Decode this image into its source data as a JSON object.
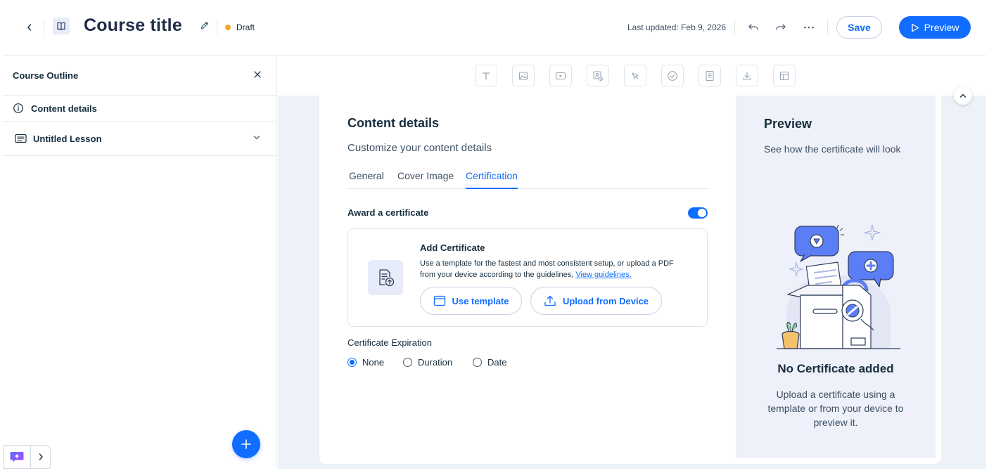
{
  "header": {
    "title": "Course title",
    "status": "Draft",
    "last_updated": "Last updated: Feb 9, 2026",
    "save_label": "Save",
    "preview_label": "Preview",
    "status_color": "#f5a623",
    "accent_color": "#116dff"
  },
  "sidebar": {
    "title": "Course Outline",
    "items": [
      {
        "label": "Content details",
        "icon": "info-icon"
      },
      {
        "label": "Untitled Lesson",
        "icon": "lesson-icon"
      }
    ]
  },
  "toolbar": {
    "tools": [
      "text-icon",
      "image-icon",
      "video-icon",
      "media-icon",
      "cursor-icon",
      "check-icon",
      "document-icon",
      "download-icon",
      "layout-icon"
    ]
  },
  "content": {
    "title": "Content details",
    "subtitle": "Customize your content details",
    "tabs": [
      "General",
      "Cover Image",
      "Certification"
    ],
    "active_tab": "Certification",
    "award_label": "Award a certificate",
    "award_enabled": true,
    "cert": {
      "title": "Add Certificate",
      "description": "Use a template for the fastest and most consistent setup, or upload a PDF from your device according to the guidelines,",
      "link": "View guidelines.",
      "use_template": "Use template",
      "upload": "Upload from Device"
    },
    "expiration": {
      "label": "Certificate Expiration",
      "options": [
        "None",
        "Duration",
        "Date"
      ],
      "selected": "None"
    }
  },
  "preview": {
    "title": "Preview",
    "subtitle": "See how the certificate will look",
    "empty_title": "No Certificate added",
    "empty_desc": "Upload a certificate using a template or from your device to preview it."
  }
}
